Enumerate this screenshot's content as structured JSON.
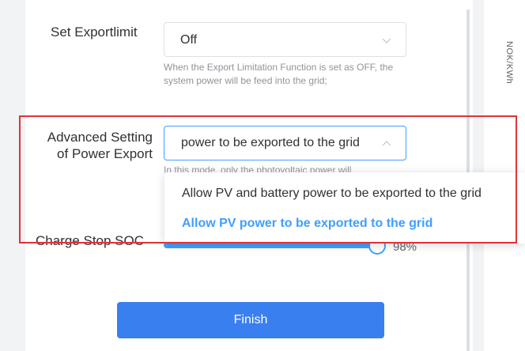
{
  "export_limit": {
    "label": "Set Exportlimit",
    "value": "Off",
    "help": "When the Export Limitation Function is set as OFF, the system power will be feed into the grid;"
  },
  "advanced_export": {
    "label_line1": "Advanced Setting",
    "label_line2": "of Power Export",
    "value": "power to be exported to the grid",
    "help_partial": "In this mode, only the photovoltaic power will"
  },
  "dropdown": {
    "options": [
      {
        "label": "Allow PV and battery power to be exported to the grid",
        "selected": false
      },
      {
        "label": "Allow PV power to be exported to the grid",
        "selected": true
      }
    ]
  },
  "charge_stop_soc": {
    "label": "Charge Stop SOC",
    "value": "98%",
    "level_percent": 98
  },
  "finish_button": {
    "label": "Finish"
  },
  "side_panel": {
    "text": "NOK/KWh"
  },
  "colors": {
    "accent": "#409eff",
    "button": "#3a7ff0",
    "highlight_box": "#e0333a"
  }
}
